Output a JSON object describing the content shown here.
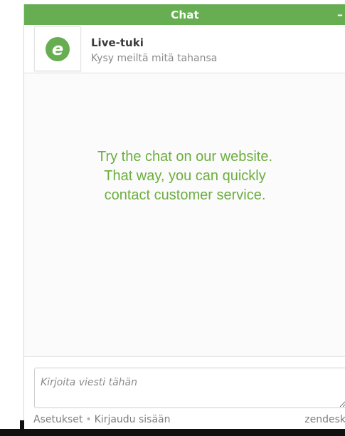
{
  "colors": {
    "accent": "#67ad52",
    "message": "#6cae3f"
  },
  "titlebar": {
    "title": "Chat",
    "minimize_label": "–",
    "minimize_icon": "minimize-icon"
  },
  "header": {
    "logo_icon": "e-logo-icon",
    "logo_letter": "e",
    "agent_name": "Live-tuki",
    "agent_subtitle": "Kysy meiltä mitä tahansa"
  },
  "chat": {
    "message_lines": [
      "Try the chat on our website.",
      "That way, you can quickly",
      "contact customer service."
    ]
  },
  "input": {
    "placeholder": "Kirjoita viesti tähän",
    "value": ""
  },
  "footer": {
    "settings_link": "Asetukset",
    "separator": "•",
    "login_link": "Kirjaudu sisään",
    "brand": "zendesk"
  }
}
